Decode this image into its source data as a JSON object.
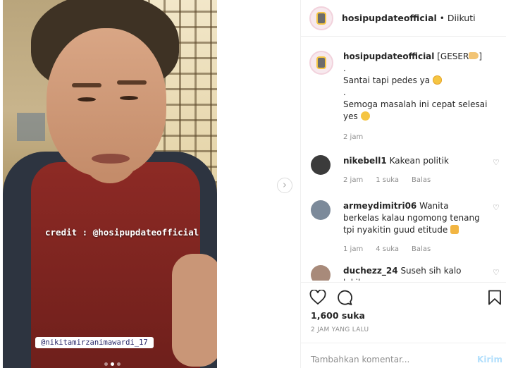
{
  "post": {
    "credit_overlay": "credit : @hosipupdateofficial",
    "mention_sticker": "@nikitamirzanimawardi_17",
    "carousel": {
      "count": 3,
      "active": 2
    }
  },
  "header": {
    "username": "hosipupdateofficial",
    "separator": "•",
    "follow_status": "Diikuti"
  },
  "caption": {
    "username": "hosipupdateofficial",
    "line1": "[GESER",
    "line1_end": "]",
    "line2": ".",
    "line3": "Santai tapi pedes ya",
    "line4": ".",
    "line5": "Semoga masalah ini cepat selesai",
    "line6": "yes",
    "time": "2 jam"
  },
  "comments": [
    {
      "username": "nikebell1",
      "text": "Kakean politik",
      "time": "2 jam",
      "likes": "1 suka",
      "reply": "Balas",
      "avatar_color": "#3b3b3b"
    },
    {
      "username": "armeydimitri06",
      "text": "Wanita berkelas kalau ngomong tenang tpi nyakitin guud etitude",
      "time": "1 jam",
      "likes": "4 suka",
      "reply": "Balas",
      "avatar_color": "#7c8a9a"
    },
    {
      "username": "duchezz_24",
      "text": "Suseh sih kalo lakik",
      "avatar_color": "#a88a7a"
    }
  ],
  "footer": {
    "likes": "1,600 suka",
    "time": "2 JAM YANG LALU",
    "comment_placeholder": "Tambahkan komentar...",
    "send_label": "Kirim"
  },
  "colors": {
    "link_disabled": "#b2dffc",
    "muted": "#8e8e8e",
    "border": "#efefef"
  }
}
